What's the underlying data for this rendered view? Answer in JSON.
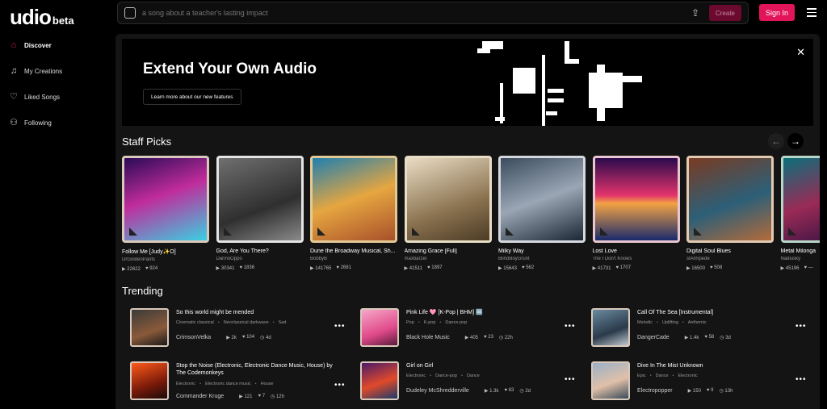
{
  "logo": {
    "wordmark": "udio",
    "suffix": "beta"
  },
  "search": {
    "placeholder": "a song about a teacher's lasting impact",
    "create_label": "Create"
  },
  "header": {
    "signin_label": "Sign In"
  },
  "sidebar": {
    "items": [
      {
        "label": "Discover",
        "icon": "home-icon",
        "active": true
      },
      {
        "label": "My Creations",
        "icon": "music-note-icon",
        "active": false
      },
      {
        "label": "Liked Songs",
        "icon": "heart-icon",
        "active": false
      },
      {
        "label": "Following",
        "icon": "user-icon",
        "active": false
      }
    ]
  },
  "banner": {
    "title": "Extend Your Own Audio",
    "button": "Learn more about our new features"
  },
  "staff_picks": {
    "title": "Staff Picks",
    "items": [
      {
        "title": "Follow Me [Judy✨O]",
        "artist": "DrGoldenPants",
        "plays": "22622",
        "likes": "924"
      },
      {
        "title": "God, Are You There?",
        "artist": "DannoOppo",
        "plays": "30341",
        "likes": "1836"
      },
      {
        "title": "Dune the Broadway Musical, Sh...",
        "artist": "BobbyB",
        "plays": "141765",
        "likes": "2681"
      },
      {
        "title": "Amazing Grace [Full]",
        "artist": "maxbarzel",
        "plays": "41511",
        "likes": "1897"
      },
      {
        "title": "Milky Way",
        "artist": "BlindBoyGrunt",
        "plays": "15643",
        "likes": "562"
      },
      {
        "title": "Lost Love",
        "artist": "The I Don't Knows",
        "plays": "41731",
        "likes": "1707"
      },
      {
        "title": "Digital Soul Blues",
        "artist": "stAImpede",
        "plays": "16500",
        "likes": "508"
      },
      {
        "title": "Metal Milonga",
        "artist": "Nadiusky",
        "plays": "45196",
        "likes": "—"
      }
    ]
  },
  "trending": {
    "title": "Trending",
    "items": [
      {
        "title": "So this world might be mended",
        "tags": [
          "Cinematic classical",
          "Neoclassical darkwave",
          "Sad"
        ],
        "artist": "CrimsonVelka",
        "plays": "2k",
        "likes": "104",
        "age": "4d"
      },
      {
        "title": "Pink Life 🩷 [K-Pop | BHM] 🆒",
        "tags": [
          "Pop",
          "K-pop",
          "Dance-pop"
        ],
        "artist": "Black Hole Music",
        "plays": "405",
        "likes": "23",
        "age": "22h"
      },
      {
        "title": "Call Of The Sea [Instrumental]",
        "tags": [
          "Melodic",
          "Uplifting",
          "Anthemic"
        ],
        "artist": "DangerCade",
        "plays": "1.4k",
        "likes": "58",
        "age": "3d"
      },
      {
        "title": "Stop the Noise (Electronic, Electronic Dance Music, House) by The Codemonkeys",
        "tags": [
          "Electronic",
          "Electronic dance music",
          "House"
        ],
        "artist": "Commander Kruge",
        "plays": "121",
        "likes": "7",
        "age": "12h"
      },
      {
        "title": "Girl on Girl",
        "tags": [
          "Electronic",
          "Dance-pop",
          "Dance"
        ],
        "artist": "Dudeley McShredderville",
        "plays": "1.3k",
        "likes": "63",
        "age": "2d"
      },
      {
        "title": "Dive In The Mist Unknown",
        "tags": [
          "Epic",
          "Dance",
          "Electronic"
        ],
        "artist": "Electropopper",
        "plays": "150",
        "likes": "9",
        "age": "13h"
      }
    ]
  },
  "colors": {
    "accent": "#e3155a",
    "panel": "#141414",
    "create_disabled": "#6b0a2e"
  }
}
